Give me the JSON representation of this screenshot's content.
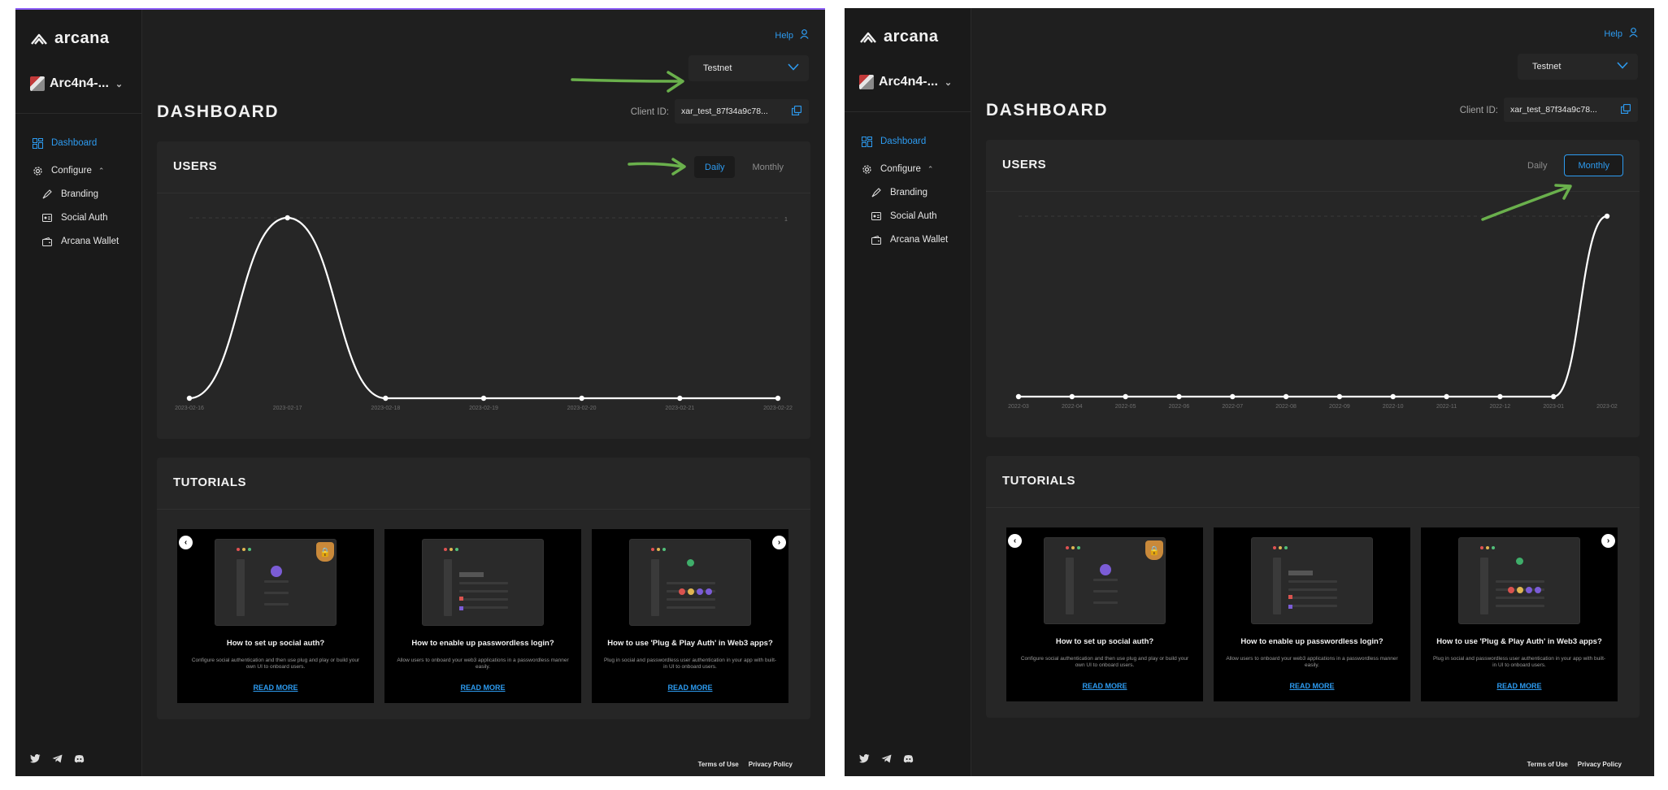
{
  "colors": {
    "accent": "#2d9bf0",
    "panel_bg": "#1f1f1f",
    "card_bg": "#262626",
    "annotation": "#6ab04c"
  },
  "panels": [
    {
      "brand": "arcana",
      "app_name": "Arc4n4-...",
      "nav": {
        "dashboard": "Dashboard",
        "configure": "Configure",
        "branding": "Branding",
        "social_auth": "Social Auth",
        "arcana_wallet": "Arcana Wallet"
      },
      "help": "Help",
      "network": "Testnet",
      "title": "DASHBOARD",
      "client_label": "Client ID:",
      "client_id": "xar_test_87f34a9c78...",
      "users_title": "USERS",
      "toggle": {
        "daily": "Daily",
        "monthly": "Monthly",
        "selected": "Daily"
      },
      "tutorials_title": "TUTORIALS",
      "tutorials": [
        {
          "title": "How to set up social auth?",
          "desc": "Configure social authentication and then use plug and play or build your own UI to onboard users.",
          "cta": "READ MORE"
        },
        {
          "title": "How to enable up passwordless login?",
          "desc": "Allow users to onboard your web3 applications in a passwordless manner easily.",
          "cta": "READ MORE"
        },
        {
          "title": "How to use 'Plug & Play Auth' in Web3 apps?",
          "desc": "Plug in social and passwordless user authentication in your app with built-in UI to onboard users.",
          "cta": "READ MORE"
        }
      ],
      "footer": {
        "terms": "Terms of Use",
        "privacy": "Privacy Policy"
      }
    },
    {
      "brand": "arcana",
      "app_name": "Arc4n4-...",
      "nav": {
        "dashboard": "Dashboard",
        "configure": "Configure",
        "branding": "Branding",
        "social_auth": "Social Auth",
        "arcana_wallet": "Arcana Wallet"
      },
      "help": "Help",
      "network": "Testnet",
      "title": "DASHBOARD",
      "client_label": "Client ID:",
      "client_id": "xar_test_87f34a9c78...",
      "users_title": "USERS",
      "toggle": {
        "daily": "Daily",
        "monthly": "Monthly",
        "selected": "Monthly"
      },
      "tutorials_title": "TUTORIALS",
      "tutorials": [
        {
          "title": "How to set up social auth?",
          "desc": "Configure social authentication and then use plug and play or build your own UI to onboard users.",
          "cta": "READ MORE"
        },
        {
          "title": "How to enable up passwordless login?",
          "desc": "Allow users to onboard your web3 applications in a passwordless manner easily.",
          "cta": "READ MORE"
        },
        {
          "title": "How to use 'Plug & Play Auth' in Web3 apps?",
          "desc": "Plug in social and passwordless user authentication in your app with built-in UI to onboard users.",
          "cta": "READ MORE"
        }
      ],
      "footer": {
        "terms": "Terms of Use",
        "privacy": "Privacy Policy"
      }
    }
  ],
  "chart_data": [
    {
      "type": "line",
      "title": "",
      "x": [
        "2023-02-16",
        "2023-02-17",
        "2023-02-18",
        "2023-02-19",
        "2023-02-20",
        "2023-02-21",
        "2023-02-22"
      ],
      "series": [
        {
          "values": [
            0,
            1,
            0,
            0,
            0,
            0,
            0
          ]
        }
      ],
      "ylim": [
        0,
        1
      ],
      "y_tick_labels": [
        "1"
      ],
      "grid": true
    },
    {
      "type": "line",
      "title": "",
      "x": [
        "2022-03",
        "2022-04",
        "2022-05",
        "2022-06",
        "2022-07",
        "2022-08",
        "2022-09",
        "2022-10",
        "2022-11",
        "2022-12",
        "2023-01",
        "2023-02"
      ],
      "series": [
        {
          "values": [
            0,
            0,
            0,
            0,
            0,
            0,
            0,
            0,
            0,
            0,
            0,
            1
          ]
        }
      ],
      "ylim": [
        0,
        1
      ],
      "grid": true
    }
  ]
}
